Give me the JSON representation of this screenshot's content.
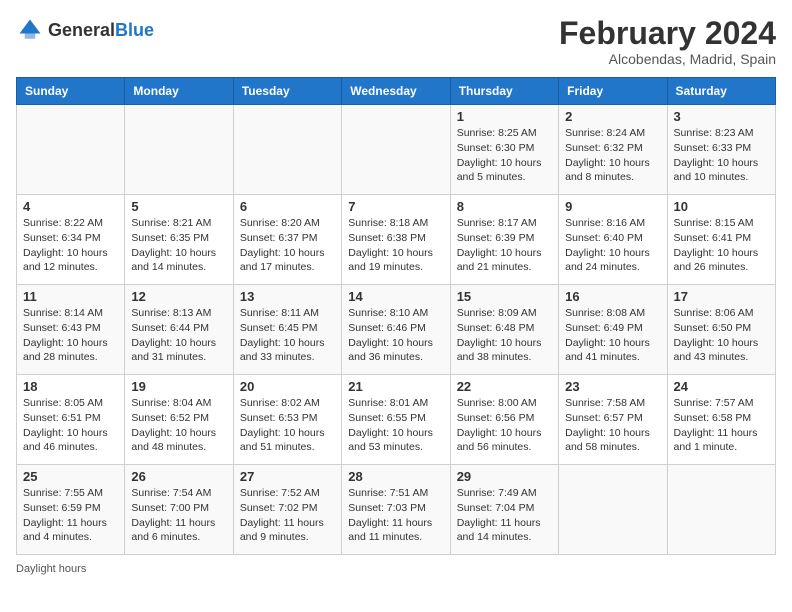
{
  "logo": {
    "general": "General",
    "blue": "Blue"
  },
  "title": "February 2024",
  "subtitle": "Alcobendas, Madrid, Spain",
  "days_header": [
    "Sunday",
    "Monday",
    "Tuesday",
    "Wednesday",
    "Thursday",
    "Friday",
    "Saturday"
  ],
  "weeks": [
    [
      {
        "day": "",
        "info": ""
      },
      {
        "day": "",
        "info": ""
      },
      {
        "day": "",
        "info": ""
      },
      {
        "day": "",
        "info": ""
      },
      {
        "day": "1",
        "info": "Sunrise: 8:25 AM\nSunset: 6:30 PM\nDaylight: 10 hours\nand 5 minutes."
      },
      {
        "day": "2",
        "info": "Sunrise: 8:24 AM\nSunset: 6:32 PM\nDaylight: 10 hours\nand 8 minutes."
      },
      {
        "day": "3",
        "info": "Sunrise: 8:23 AM\nSunset: 6:33 PM\nDaylight: 10 hours\nand 10 minutes."
      }
    ],
    [
      {
        "day": "4",
        "info": "Sunrise: 8:22 AM\nSunset: 6:34 PM\nDaylight: 10 hours\nand 12 minutes."
      },
      {
        "day": "5",
        "info": "Sunrise: 8:21 AM\nSunset: 6:35 PM\nDaylight: 10 hours\nand 14 minutes."
      },
      {
        "day": "6",
        "info": "Sunrise: 8:20 AM\nSunset: 6:37 PM\nDaylight: 10 hours\nand 17 minutes."
      },
      {
        "day": "7",
        "info": "Sunrise: 8:18 AM\nSunset: 6:38 PM\nDaylight: 10 hours\nand 19 minutes."
      },
      {
        "day": "8",
        "info": "Sunrise: 8:17 AM\nSunset: 6:39 PM\nDaylight: 10 hours\nand 21 minutes."
      },
      {
        "day": "9",
        "info": "Sunrise: 8:16 AM\nSunset: 6:40 PM\nDaylight: 10 hours\nand 24 minutes."
      },
      {
        "day": "10",
        "info": "Sunrise: 8:15 AM\nSunset: 6:41 PM\nDaylight: 10 hours\nand 26 minutes."
      }
    ],
    [
      {
        "day": "11",
        "info": "Sunrise: 8:14 AM\nSunset: 6:43 PM\nDaylight: 10 hours\nand 28 minutes."
      },
      {
        "day": "12",
        "info": "Sunrise: 8:13 AM\nSunset: 6:44 PM\nDaylight: 10 hours\nand 31 minutes."
      },
      {
        "day": "13",
        "info": "Sunrise: 8:11 AM\nSunset: 6:45 PM\nDaylight: 10 hours\nand 33 minutes."
      },
      {
        "day": "14",
        "info": "Sunrise: 8:10 AM\nSunset: 6:46 PM\nDaylight: 10 hours\nand 36 minutes."
      },
      {
        "day": "15",
        "info": "Sunrise: 8:09 AM\nSunset: 6:48 PM\nDaylight: 10 hours\nand 38 minutes."
      },
      {
        "day": "16",
        "info": "Sunrise: 8:08 AM\nSunset: 6:49 PM\nDaylight: 10 hours\nand 41 minutes."
      },
      {
        "day": "17",
        "info": "Sunrise: 8:06 AM\nSunset: 6:50 PM\nDaylight: 10 hours\nand 43 minutes."
      }
    ],
    [
      {
        "day": "18",
        "info": "Sunrise: 8:05 AM\nSunset: 6:51 PM\nDaylight: 10 hours\nand 46 minutes."
      },
      {
        "day": "19",
        "info": "Sunrise: 8:04 AM\nSunset: 6:52 PM\nDaylight: 10 hours\nand 48 minutes."
      },
      {
        "day": "20",
        "info": "Sunrise: 8:02 AM\nSunset: 6:53 PM\nDaylight: 10 hours\nand 51 minutes."
      },
      {
        "day": "21",
        "info": "Sunrise: 8:01 AM\nSunset: 6:55 PM\nDaylight: 10 hours\nand 53 minutes."
      },
      {
        "day": "22",
        "info": "Sunrise: 8:00 AM\nSunset: 6:56 PM\nDaylight: 10 hours\nand 56 minutes."
      },
      {
        "day": "23",
        "info": "Sunrise: 7:58 AM\nSunset: 6:57 PM\nDaylight: 10 hours\nand 58 minutes."
      },
      {
        "day": "24",
        "info": "Sunrise: 7:57 AM\nSunset: 6:58 PM\nDaylight: 11 hours\nand 1 minute."
      }
    ],
    [
      {
        "day": "25",
        "info": "Sunrise: 7:55 AM\nSunset: 6:59 PM\nDaylight: 11 hours\nand 4 minutes."
      },
      {
        "day": "26",
        "info": "Sunrise: 7:54 AM\nSunset: 7:00 PM\nDaylight: 11 hours\nand 6 minutes."
      },
      {
        "day": "27",
        "info": "Sunrise: 7:52 AM\nSunset: 7:02 PM\nDaylight: 11 hours\nand 9 minutes."
      },
      {
        "day": "28",
        "info": "Sunrise: 7:51 AM\nSunset: 7:03 PM\nDaylight: 11 hours\nand 11 minutes."
      },
      {
        "day": "29",
        "info": "Sunrise: 7:49 AM\nSunset: 7:04 PM\nDaylight: 11 hours\nand 14 minutes."
      },
      {
        "day": "",
        "info": ""
      },
      {
        "day": "",
        "info": ""
      }
    ]
  ],
  "footer": {
    "daylight_label": "Daylight hours"
  }
}
